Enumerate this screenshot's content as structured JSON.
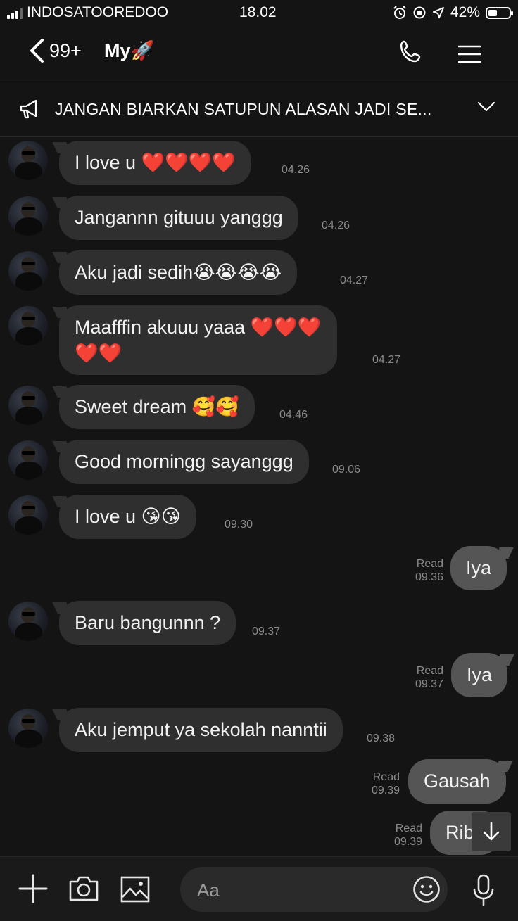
{
  "status_bar": {
    "carrier": "INDOSATOOREDOO",
    "time": "18.02",
    "battery": "42%",
    "battery_level": 0.42
  },
  "header": {
    "back_count": "99+",
    "title": "My🚀",
    "call_icon": "phone-icon",
    "menu_icon": "hamburger-menu-icon"
  },
  "announcement": {
    "icon": "megaphone-icon",
    "text": "JANGAN BIARKAN SATUPUN ALASAN JADI SE...",
    "chevron": "chevron-down-icon"
  },
  "messages": [
    {
      "side": "in",
      "text": "I love u ❤️❤️❤️❤️",
      "time": "04.26"
    },
    {
      "side": "in",
      "text": "Jangannn gituuu yanggg",
      "time": "04.26"
    },
    {
      "side": "in",
      "text": "Aku jadi sedih😭😭😭😭",
      "time": "04.27"
    },
    {
      "side": "in",
      "text": "Maafffin akuuu yaaa ❤️❤️❤️",
      "text2": "❤️❤️",
      "time": "04.27"
    },
    {
      "side": "in",
      "text": "Sweet dream 🥰🥰",
      "time": "04.46"
    },
    {
      "side": "in",
      "text": "Good morningg sayanggg",
      "time": "09.06"
    },
    {
      "side": "in",
      "text": "I love u 😘😘",
      "time": "09.30"
    },
    {
      "side": "out",
      "text": "Iya",
      "read": "Read",
      "time": "09.36"
    },
    {
      "side": "in",
      "text": "Baru bangunnn ?",
      "time": "09.37"
    },
    {
      "side": "out",
      "text": "Iya",
      "read": "Read",
      "time": "09.37"
    },
    {
      "side": "in",
      "text": "Aku jemput ya sekolah nanntii",
      "time": "09.38"
    },
    {
      "side": "out",
      "text": "Gausah",
      "read": "Read",
      "time": "09.39"
    },
    {
      "side": "out",
      "text": "Ribe",
      "read": "Read",
      "time": "09.39"
    }
  ],
  "input_bar": {
    "placeholder": "Aa",
    "icons": [
      "plus-icon",
      "camera-icon",
      "image-icon",
      "emoji-icon",
      "microphone-icon"
    ]
  },
  "colors": {
    "background": "#141414",
    "incoming_bubble": "#2f2f2f",
    "outgoing_bubble": "#555555",
    "muted_text": "#8a8a8a"
  }
}
